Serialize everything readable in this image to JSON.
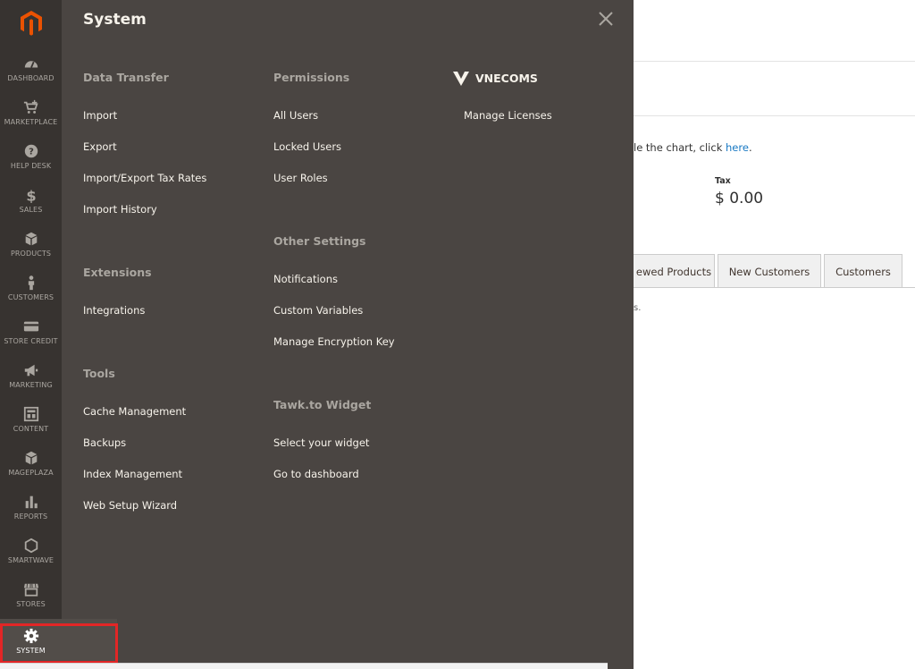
{
  "sidebar": {
    "logo_icon": "magento-logo-icon",
    "items": [
      {
        "label": "DASHBOARD",
        "icon": "speedometer-icon"
      },
      {
        "label": "MARKETPLACE",
        "icon": "cart-plus-icon"
      },
      {
        "label": "HELP DESK",
        "icon": "help-circle-icon"
      },
      {
        "label": "SALES",
        "icon": "dollar-icon"
      },
      {
        "label": "PRODUCTS",
        "icon": "box-icon"
      },
      {
        "label": "CUSTOMERS",
        "icon": "person-icon"
      },
      {
        "label": "STORE CREDIT",
        "icon": "credit-card-icon"
      },
      {
        "label": "MARKETING",
        "icon": "megaphone-icon"
      },
      {
        "label": "CONTENT",
        "icon": "layout-icon"
      },
      {
        "label": "MAGEPLAZA",
        "icon": "box-icon"
      },
      {
        "label": "REPORTS",
        "icon": "bar-chart-icon"
      },
      {
        "label": "SMARTWAVE",
        "icon": "hexagon-icon"
      },
      {
        "label": "STORES",
        "icon": "storefront-icon"
      },
      {
        "label": "SYSTEM",
        "icon": "gear-icon"
      }
    ]
  },
  "flyout": {
    "title": "System",
    "columns": {
      "col1": {
        "data_transfer": {
          "title": "Data Transfer",
          "links": [
            "Import",
            "Export",
            "Import/Export Tax Rates",
            "Import History"
          ]
        },
        "extensions": {
          "title": "Extensions",
          "links": [
            "Integrations"
          ]
        },
        "tools": {
          "title": "Tools",
          "links": [
            "Cache Management",
            "Backups",
            "Index Management",
            "Web Setup Wizard"
          ]
        }
      },
      "col2": {
        "permissions": {
          "title": "Permissions",
          "links": [
            "All Users",
            "Locked Users",
            "User Roles"
          ]
        },
        "other_settings": {
          "title": "Other Settings",
          "links": [
            "Notifications",
            "Custom Variables",
            "Manage Encryption Key"
          ]
        },
        "tawk": {
          "title": "Tawk.to Widget",
          "links": [
            "Select your widget",
            "Go to dashboard"
          ]
        }
      },
      "col3": {
        "vnecoms": {
          "title": "VNECOMS",
          "links": [
            "Manage Licenses"
          ]
        }
      }
    }
  },
  "dashboard": {
    "chart_note_prefix": "le the chart, click ",
    "chart_note_link": "here",
    "chart_note_suffix": ".",
    "tax_label": "Tax",
    "tax_value": "$ 0.00",
    "tabs": [
      "ewed Products",
      "New Customers",
      "Customers"
    ],
    "empty_note": "s."
  },
  "colors": {
    "sidebar_bg": "#373330",
    "flyout_bg": "#4a4542",
    "accent_orange": "#eb5202",
    "link_blue": "#1979c3",
    "highlight_red": "#e22626"
  }
}
